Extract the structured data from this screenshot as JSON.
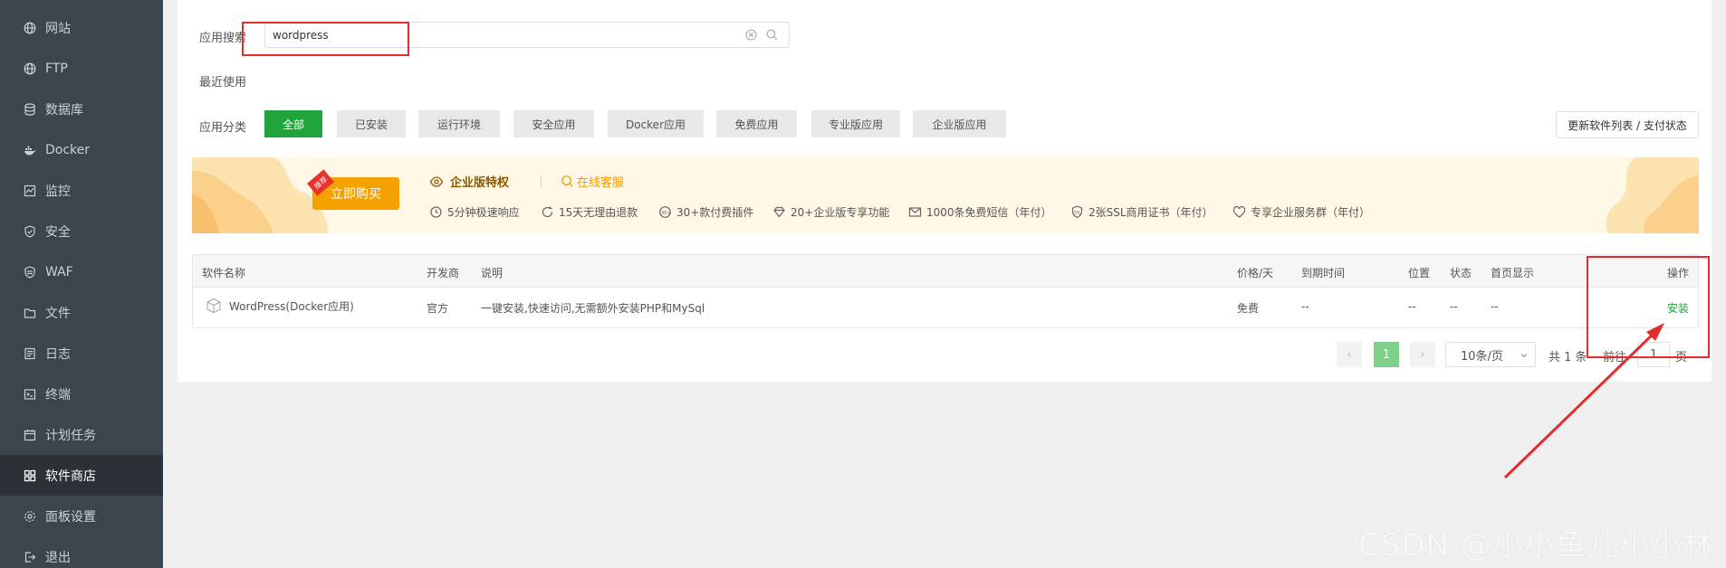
{
  "sidebar": {
    "items": [
      {
        "label": "网站",
        "icon": "globe-icon"
      },
      {
        "label": "FTP",
        "icon": "globe-icon"
      },
      {
        "label": "数据库",
        "icon": "database-icon"
      },
      {
        "label": "Docker",
        "icon": "docker-icon"
      },
      {
        "label": "监控",
        "icon": "monitor-icon"
      },
      {
        "label": "安全",
        "icon": "shield-icon"
      },
      {
        "label": "WAF",
        "icon": "shield-icon"
      },
      {
        "label": "文件",
        "icon": "folder-icon"
      },
      {
        "label": "日志",
        "icon": "log-icon"
      },
      {
        "label": "终端",
        "icon": "terminal-icon"
      },
      {
        "label": "计划任务",
        "icon": "calendar-icon"
      },
      {
        "label": "软件商店",
        "icon": "grid-icon",
        "active": true
      },
      {
        "label": "面板设置",
        "icon": "gear-icon"
      },
      {
        "label": "退出",
        "icon": "logout-icon"
      }
    ]
  },
  "search": {
    "label": "应用搜索",
    "value": "wordpress"
  },
  "recent": {
    "label": "最近使用"
  },
  "categories": {
    "label": "应用分类",
    "items": [
      "全部",
      "已安装",
      "运行环境",
      "安全应用",
      "Docker应用",
      "免费应用",
      "专业版应用",
      "企业版应用"
    ],
    "update_label": "更新软件列表 / 支付状态"
  },
  "banner": {
    "buy_label": "立即购买",
    "tag": "推荐",
    "title": "企业版特权",
    "service_label": "在线客服",
    "features": [
      "5分钟极速响应",
      "15天无理由退款",
      "30+款付费插件",
      "20+企业版专享功能",
      "1000条免费短信（年付）",
      "2张SSL商用证书（年付）",
      "专享企业服务群（年付）"
    ]
  },
  "table": {
    "headers": {
      "name": "软件名称",
      "vendor": "开发商",
      "desc": "说明",
      "price": "价格/天",
      "expire": "到期时间",
      "position": "位置",
      "status": "状态",
      "home": "首页显示",
      "action": "操作"
    },
    "rows": [
      {
        "name": "WordPress(Docker应用)",
        "vendor": "官方",
        "desc": "一键安装,快速访问,无需额外安装PHP和MySql",
        "price": "免费",
        "expire": "--",
        "position": "--",
        "status": "--",
        "home": "--",
        "action": "安装"
      }
    ]
  },
  "pagination": {
    "prev": "‹",
    "current": "1",
    "next": "›",
    "per_page": "10条/页",
    "total": "共 1 条",
    "goto_label": "前往",
    "goto_value": "1",
    "page_unit": "页"
  },
  "watermark": "CSDN @小小鱼儿小小林",
  "colors": {
    "accent": "#20a53a",
    "sidebar_bg": "#3c444d",
    "banner_orange": "#f5a200",
    "annotation_red": "#e42c2c"
  }
}
